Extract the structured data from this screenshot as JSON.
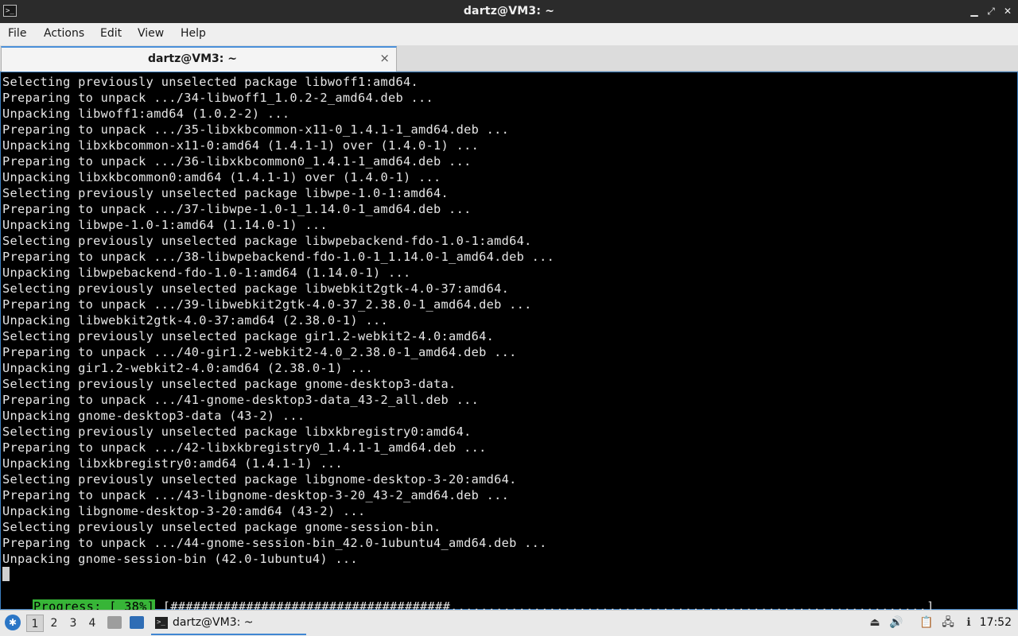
{
  "window": {
    "title": "dartz@VM3: ~",
    "app_icon_glyph": ">_"
  },
  "menu": [
    "File",
    "Actions",
    "Edit",
    "View",
    "Help"
  ],
  "tab": {
    "label": "dartz@VM3: ~",
    "close_glyph": "×"
  },
  "terminal": {
    "lines": [
      "Selecting previously unselected package libwoff1:amd64.",
      "Preparing to unpack .../34-libwoff1_1.0.2-2_amd64.deb ...",
      "Unpacking libwoff1:amd64 (1.0.2-2) ...",
      "Preparing to unpack .../35-libxkbcommon-x11-0_1.4.1-1_amd64.deb ...",
      "Unpacking libxkbcommon-x11-0:amd64 (1.4.1-1) over (1.4.0-1) ...",
      "Preparing to unpack .../36-libxkbcommon0_1.4.1-1_amd64.deb ...",
      "Unpacking libxkbcommon0:amd64 (1.4.1-1) over (1.4.0-1) ...",
      "Selecting previously unselected package libwpe-1.0-1:amd64.",
      "Preparing to unpack .../37-libwpe-1.0-1_1.14.0-1_amd64.deb ...",
      "Unpacking libwpe-1.0-1:amd64 (1.14.0-1) ...",
      "Selecting previously unselected package libwpebackend-fdo-1.0-1:amd64.",
      "Preparing to unpack .../38-libwpebackend-fdo-1.0-1_1.14.0-1_amd64.deb ...",
      "Unpacking libwpebackend-fdo-1.0-1:amd64 (1.14.0-1) ...",
      "Selecting previously unselected package libwebkit2gtk-4.0-37:amd64.",
      "Preparing to unpack .../39-libwebkit2gtk-4.0-37_2.38.0-1_amd64.deb ...",
      "Unpacking libwebkit2gtk-4.0-37:amd64 (2.38.0-1) ...",
      "Selecting previously unselected package gir1.2-webkit2-4.0:amd64.",
      "Preparing to unpack .../40-gir1.2-webkit2-4.0_2.38.0-1_amd64.deb ...",
      "Unpacking gir1.2-webkit2-4.0:amd64 (2.38.0-1) ...",
      "Selecting previously unselected package gnome-desktop3-data.",
      "Preparing to unpack .../41-gnome-desktop3-data_43-2_all.deb ...",
      "Unpacking gnome-desktop3-data (43-2) ...",
      "Selecting previously unselected package libxkbregistry0:amd64.",
      "Preparing to unpack .../42-libxkbregistry0_1.4.1-1_amd64.deb ...",
      "Unpacking libxkbregistry0:amd64 (1.4.1-1) ...",
      "Selecting previously unselected package libgnome-desktop-3-20:amd64.",
      "Preparing to unpack .../43-libgnome-desktop-3-20_43-2_amd64.deb ...",
      "Unpacking libgnome-desktop-3-20:amd64 (43-2) ...",
      "Selecting previously unselected package gnome-session-bin.",
      "Preparing to unpack .../44-gnome-session-bin_42.0-1ubuntu4_amd64.deb ...",
      "Unpacking gnome-session-bin (42.0-1ubuntu4) ..."
    ],
    "progress_label": "Progress: [ 38%]",
    "progress_bar": "[#####################################...............................................................]",
    "progress_value": 0.38
  },
  "taskbar": {
    "workspaces": [
      "1",
      "2",
      "3",
      "4"
    ],
    "active_workspace": "1",
    "task_label": "dartz@VM3: ~",
    "clock": "17:52"
  }
}
